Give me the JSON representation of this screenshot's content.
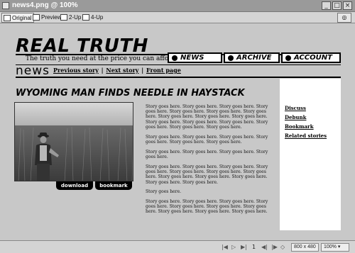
{
  "window": {
    "title": "news4.png @ 100%"
  },
  "toolbar": {
    "tabs": [
      {
        "label": "Original",
        "active": true
      },
      {
        "label": "Preview",
        "active": false
      },
      {
        "label": "2-Up",
        "active": false
      },
      {
        "label": "4-Up",
        "active": false
      }
    ]
  },
  "site": {
    "logo": "REAL TRUTH",
    "tagline": "The truth you need at the price you can afford",
    "nav": [
      "NEWS",
      "ARCHIVE",
      "ACCOUNT"
    ],
    "section_word": "news",
    "subnav": [
      "Previous story",
      "Next story",
      "Front page"
    ],
    "subnav_sep": "|"
  },
  "article": {
    "headline": "WYOMING MAN FINDS NEEDLE IN HAYSTACK",
    "photo_buttons": [
      "download",
      "bookmark"
    ],
    "paragraphs": [
      "Story goes here. Story goes here. Story goes here. Story goes here. Story goes here. Story goes here. Story goes here. Story goes here. Story goes here. Story goes here. Story goes here. Story goes here. Story goes here. Story goes here. Story goes here. Story goes here.",
      "Story goes here. Story goes here. Story goes here. Story goes here. Story goes here. Story goes here.",
      "Story goes here. Story goes here. Story goes here. Story goes here.",
      "Story goes here. Story goes here. Story goes here. Story goes here. Story goes here. Story goes here. Story goes here. Story goes here. Story goes here. Story goes here. Story goes here. Story goes here.",
      "Story goes here.",
      "Story goes here. Story goes here. Story goes here. Story goes here. Story goes here. Story goes here. Story goes here. Story goes here. Story goes here. Story goes here."
    ]
  },
  "sidebar": {
    "links": [
      "Discuss",
      "Debunk",
      "Bookmark",
      "Related stories"
    ]
  },
  "statusbar": {
    "page": "1",
    "dimensions": "800 x 480",
    "zoom": "100%"
  }
}
